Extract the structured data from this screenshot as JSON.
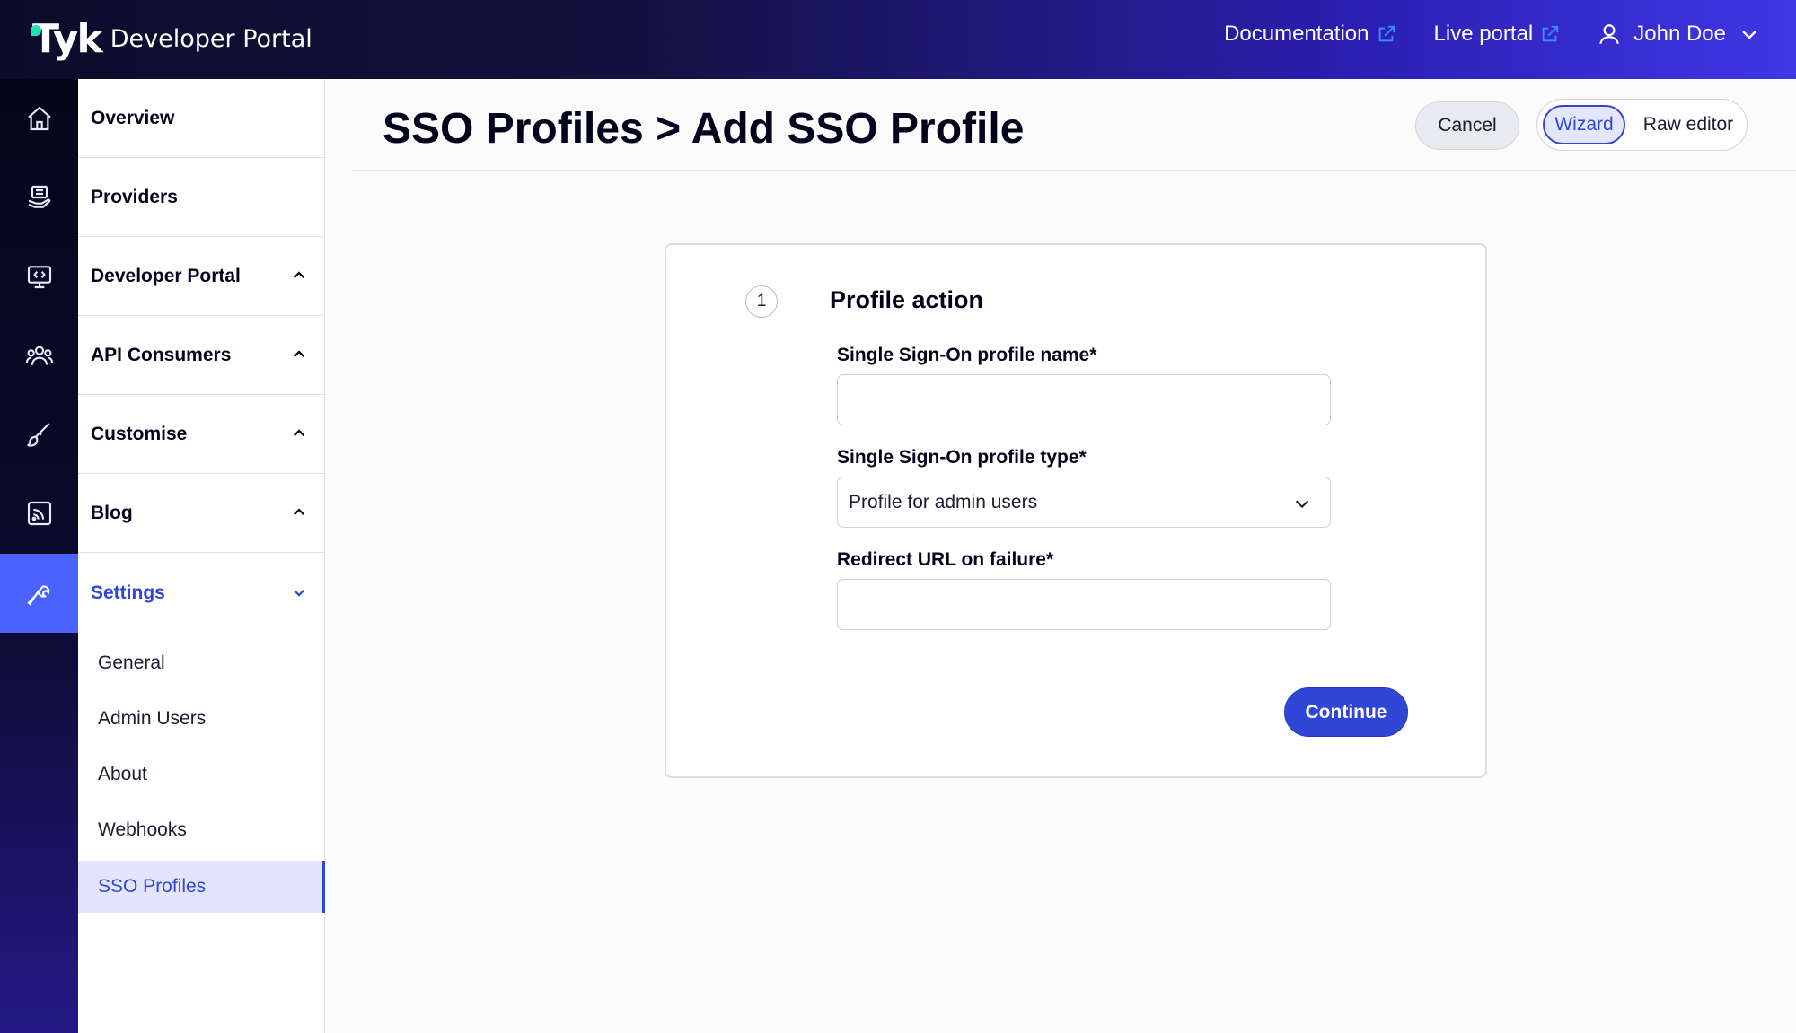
{
  "app": {
    "logo_text": "Tyk",
    "product_name": "Developer Portal"
  },
  "topbar": {
    "documentation_label": "Documentation",
    "live_portal_label": "Live portal",
    "user_name": "John Doe"
  },
  "rail": {
    "icons": [
      "home-icon",
      "providers-icon",
      "developer-portal-icon",
      "api-consumers-icon",
      "customise-icon",
      "blog-icon",
      "settings-wrench-icon"
    ],
    "active_index": 6
  },
  "nav": {
    "items": [
      {
        "label": "Overview"
      },
      {
        "label": "Providers"
      },
      {
        "label": "Developer Portal"
      },
      {
        "label": "API Consumers"
      },
      {
        "label": "Customise"
      },
      {
        "label": "Blog"
      },
      {
        "label": "Settings"
      }
    ],
    "settings_sub": [
      {
        "label": "General"
      },
      {
        "label": "Admin Users"
      },
      {
        "label": "About"
      },
      {
        "label": "Webhooks"
      },
      {
        "label": "SSO Profiles"
      }
    ]
  },
  "header": {
    "title": "SSO Profiles > Add SSO Profile",
    "cancel_label": "Cancel",
    "wizard_label": "Wizard",
    "raw_editor_label": "Raw editor"
  },
  "form": {
    "step_number": "1",
    "section_title": "Profile action",
    "name_label": "Single Sign-On profile name*",
    "name_value": "",
    "type_label": "Single Sign-On profile type*",
    "type_selected": "Profile for admin users",
    "redirect_label": "Redirect URL on failure*",
    "redirect_value": "",
    "continue_label": "Continue"
  },
  "colors": {
    "accent": "#3046d6",
    "rail_active": "#4a62ff",
    "brand_dot": "#20e3b2",
    "external_link": "#3d8bff"
  }
}
